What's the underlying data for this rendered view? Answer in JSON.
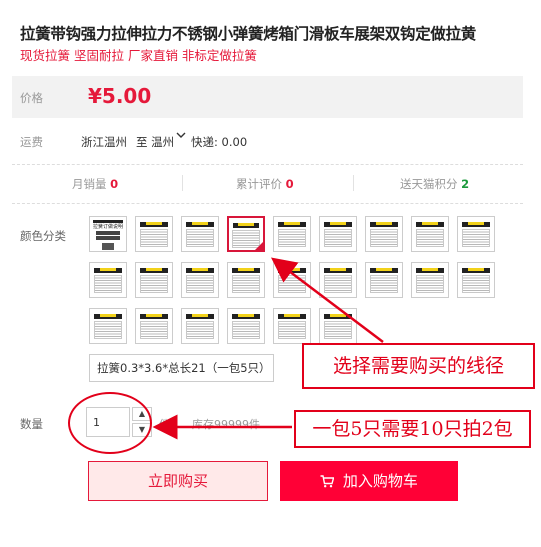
{
  "product": {
    "title": "拉簧带钩强力拉伸拉力不锈钢小弹簧烤箱门滑板车展架双钩定做拉黄",
    "subtitle": "现货拉簧 坚固耐拉 厂家直销 非标定做拉簧"
  },
  "price": {
    "label": "价格",
    "value": "¥5.00"
  },
  "shipping": {
    "label": "运费",
    "from": "浙江温州",
    "to": "至 温州",
    "fee": "快递: 0.00"
  },
  "stats": {
    "monthly_sales_label": "月销量",
    "monthly_sales_value": "0",
    "reviews_label": "累计评价",
    "reviews_value": "0",
    "points_label": "送天猫积分",
    "points_value": "2"
  },
  "color": {
    "label": "颜色分类",
    "thumb_first_title": "拉簧订做说明",
    "selected_option": "拉簧0.3*3.6*总长21（一包5只）"
  },
  "quantity": {
    "label": "数量",
    "value": "1",
    "unit": "件",
    "stock": "库存99999件"
  },
  "buttons": {
    "buy_now": "立即购买",
    "add_to_cart": "加入购物车"
  },
  "annotations": {
    "callout_choose": "选择需要购买的线径",
    "callout_qty": "一包5只需要10只拍2包"
  },
  "colors": {
    "accent": "#e5193a",
    "cart_button": "#ff0036",
    "annotation_red": "#e2001a"
  }
}
